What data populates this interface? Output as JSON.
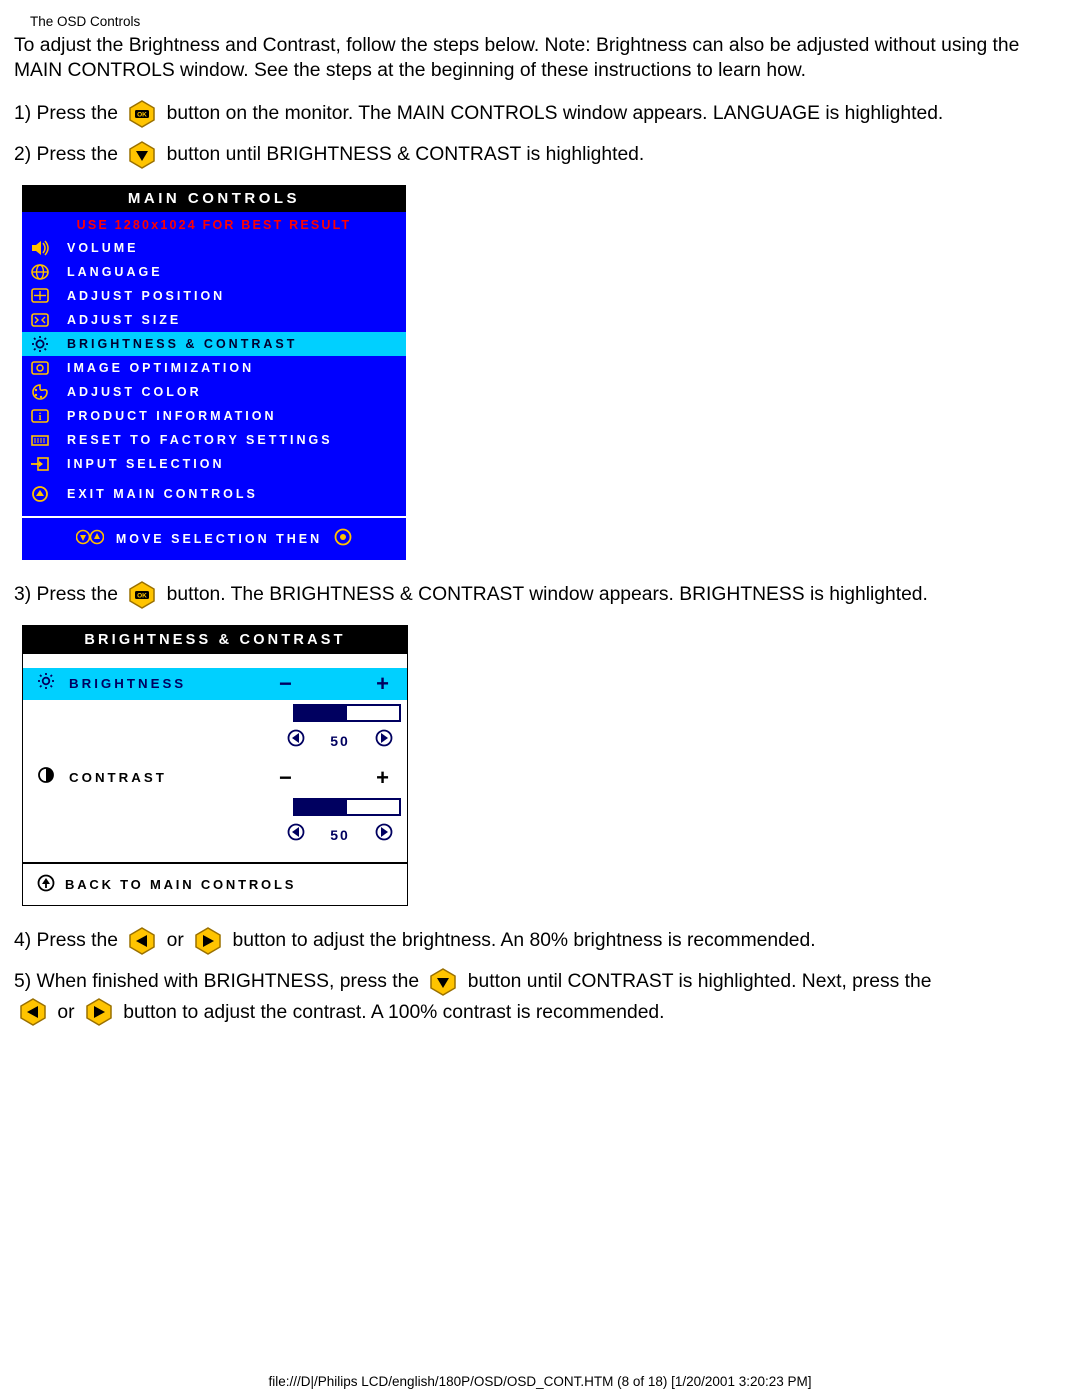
{
  "header": "The OSD Controls",
  "intro": "To adjust the Brightness and Contrast, follow the steps below. Note: Brightness can also be adjusted without using the MAIN CONTROLS window. See the steps at the beginning of these instructions to learn how.",
  "step1a": "1) Press the ",
  "step1b": " button on the monitor. The MAIN CONTROLS window appears. LANGUAGE is highlighted.",
  "step2a": "2) Press the ",
  "step2b": " button until BRIGHTNESS & CONTRAST is highlighted.",
  "osd_main": {
    "title": "MAIN CONTROLS",
    "subtitle": "USE 1280x1024 FOR BEST RESULT",
    "items": [
      {
        "label": "VOLUME",
        "icon": "volume-icon"
      },
      {
        "label": "LANGUAGE",
        "icon": "globe-icon"
      },
      {
        "label": "ADJUST POSITION",
        "icon": "position-icon"
      },
      {
        "label": "ADJUST SIZE",
        "icon": "size-icon"
      },
      {
        "label": "BRIGHTNESS & CONTRAST",
        "icon": "sun-icon",
        "highlighted": true
      },
      {
        "label": "IMAGE OPTIMIZATION",
        "icon": "optim-icon"
      },
      {
        "label": "ADJUST COLOR",
        "icon": "palette-icon"
      },
      {
        "label": "PRODUCT INFORMATION",
        "icon": "info-icon"
      },
      {
        "label": "RESET TO FACTORY SETTINGS",
        "icon": "reset-icon"
      },
      {
        "label": "INPUT SELECTION",
        "icon": "input-icon"
      }
    ],
    "exit": {
      "label": "EXIT MAIN CONTROLS",
      "icon": "exit-icon"
    },
    "footer": "MOVE SELECTION THEN"
  },
  "step3a": "3) Press the ",
  "step3b": " button. The BRIGHTNESS & CONTRAST window appears. BRIGHTNESS is highlighted.",
  "bc_panel": {
    "title": "BRIGHTNESS & CONTRAST",
    "brightness": {
      "label": "BRIGHTNESS",
      "value": "50",
      "bar_pct": 50
    },
    "contrast": {
      "label": "CONTRAST",
      "value": "50",
      "bar_pct": 50
    },
    "back": "BACK TO MAIN CONTROLS"
  },
  "step4a": "4) Press the ",
  "step4_or": " or ",
  "step4b": " button to adjust the brightness. An 80% brightness is recommended.",
  "step5a": "5) When finished with BRIGHTNESS, press the ",
  "step5b": " button until CONTRAST is highlighted. Next, press the ",
  "step5_or": " or ",
  "step5c": " button to adjust the contrast. A 100% contrast is recommended.",
  "footer": "file:///D|/Philips LCD/english/180P/OSD/OSD_CONT.HTM (8 of 18) [1/20/2001 3:20:23 PM]"
}
